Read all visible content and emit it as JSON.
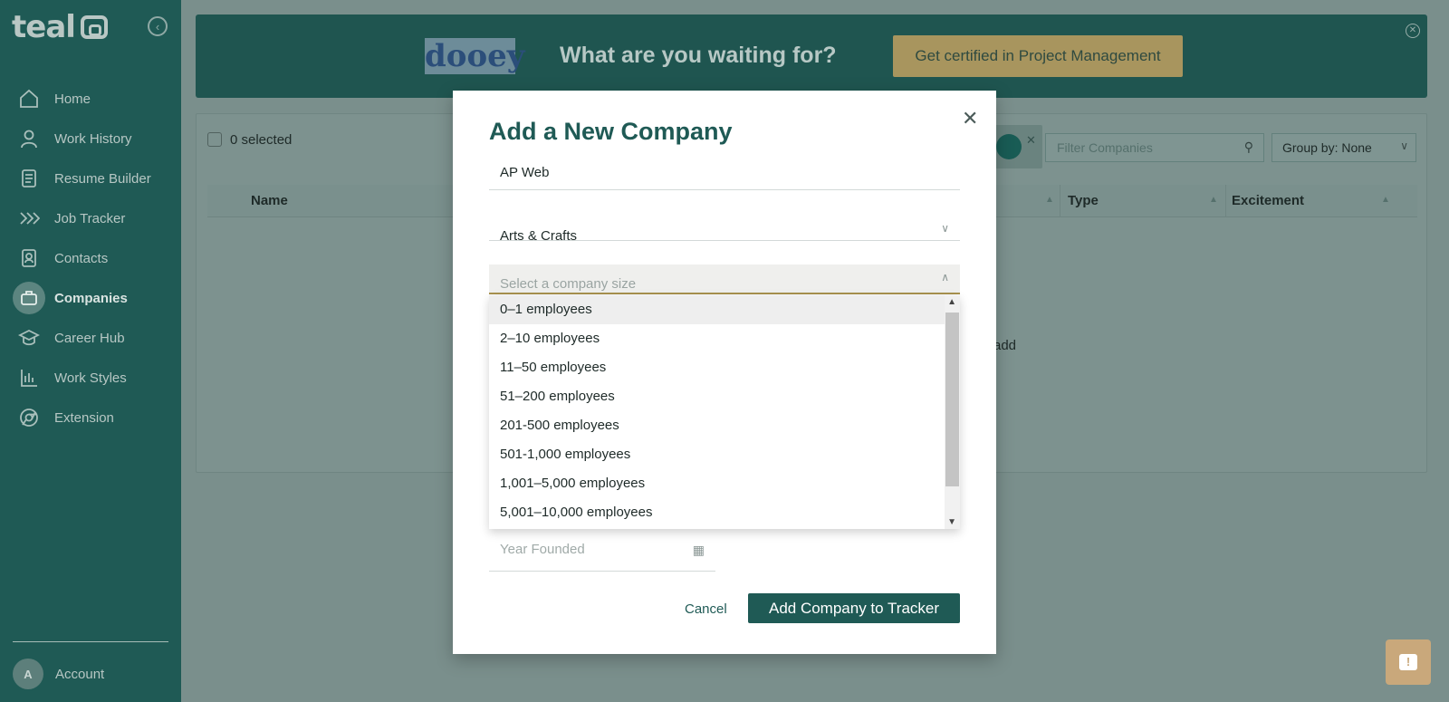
{
  "app": {
    "logo_text": "teal"
  },
  "sidebar": {
    "items": [
      {
        "label": "Home",
        "icon": "home-icon"
      },
      {
        "label": "Work History",
        "icon": "person-icon"
      },
      {
        "label": "Resume Builder",
        "icon": "document-icon"
      },
      {
        "label": "Job Tracker",
        "icon": "chevrons-icon"
      },
      {
        "label": "Contacts",
        "icon": "contact-card-icon"
      },
      {
        "label": "Companies",
        "icon": "briefcase-icon",
        "active": true
      },
      {
        "label": "Career Hub",
        "icon": "graduation-cap-icon"
      },
      {
        "label": "Work Styles",
        "icon": "bar-chart-icon"
      },
      {
        "label": "Extension",
        "icon": "chrome-icon"
      }
    ],
    "account": {
      "avatar_letter": "A",
      "label": "Account"
    }
  },
  "banner": {
    "logo_text": "dooey",
    "headline": "What are you waiting for?",
    "cta": "Get certified in Project Management"
  },
  "companies": {
    "selected_label": "0 selected",
    "filter_placeholder": "Filter Companies",
    "group_by": "Group by: None",
    "columns": [
      "Name",
      "Type",
      "Excitement"
    ],
    "empty_fragment": "add"
  },
  "modal": {
    "title": "Add a New Company",
    "company_name": "AP Web",
    "industry": "Arts & Crafts",
    "size_placeholder": "Select a company size",
    "size_options": [
      "0–1 employees",
      "2–10 employees",
      "11–50 employees",
      "51–200 employees",
      "201-500 employees",
      "501-1,000 employees",
      "1,001–5,000 employees",
      "5,001–10,000 employees"
    ],
    "year_placeholder": "Year Founded",
    "cancel_label": "Cancel",
    "submit_label": "Add Company to Tracker"
  },
  "colors": {
    "brand": "#1f5a55",
    "overlay": "#7a8f8c",
    "cta": "#a8955e",
    "feedback": "#c9a87b"
  }
}
